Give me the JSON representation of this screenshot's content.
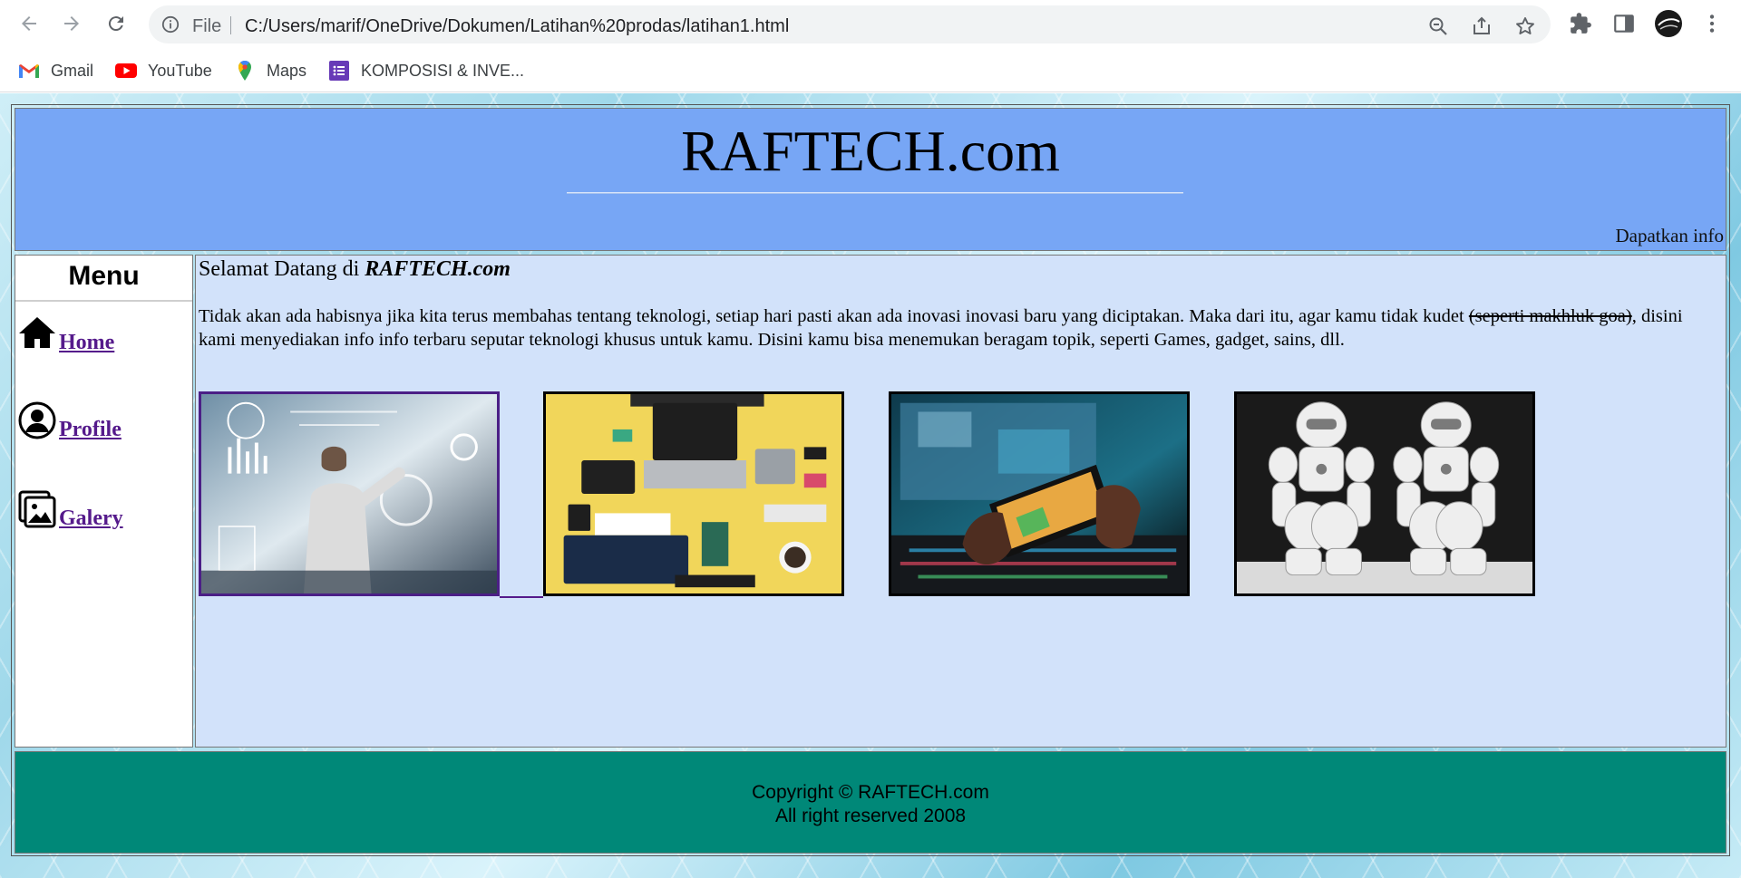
{
  "browser": {
    "scheme": "File",
    "url": "C:/Users/marif/OneDrive/Dokumen/Latihan%20prodas/latihan1.html",
    "bookmarks": [
      {
        "label": "Gmail",
        "icon": "gmail-icon"
      },
      {
        "label": "YouTube",
        "icon": "youtube-icon"
      },
      {
        "label": "Maps",
        "icon": "maps-icon"
      },
      {
        "label": "KOMPOSISI & INVE...",
        "icon": "forms-icon"
      }
    ]
  },
  "page": {
    "site_title": "RAFTECH.com",
    "marquee": "Dapatkan info",
    "menu": {
      "title": "Menu",
      "items": [
        {
          "label": "Home",
          "icon": "home-icon"
        },
        {
          "label": "Profile",
          "icon": "user-icon"
        },
        {
          "label": "Galery",
          "icon": "gallery-icon"
        }
      ]
    },
    "content": {
      "welcome_prefix": "Selamat Datang di ",
      "welcome_brand": "RAFTECH.com",
      "intro_before": "Tidak akan ada habisnya jika kita terus membahas tentang teknologi, setiap hari pasti akan ada inovasi inovasi baru yang diciptakan. Maka dari itu, agar kamu tidak kudet ",
      "intro_strike": "(seperti makhluk goa)",
      "intro_after": ", disini kami menyediakan info info terbaru seputar teknologi khusus untuk kamu. Disini kamu bisa menemukan beragam topik, seperti Games, gadget, sains, dll."
    },
    "footer": {
      "line1": "Copyright © RAFTECH.com",
      "line2": "All right reserved 2008"
    }
  },
  "colors": {
    "header_bg": "#77a6f5",
    "content_bg": "#d2e2fa",
    "footer_bg": "#008878",
    "visited_link": "#551a8b"
  }
}
